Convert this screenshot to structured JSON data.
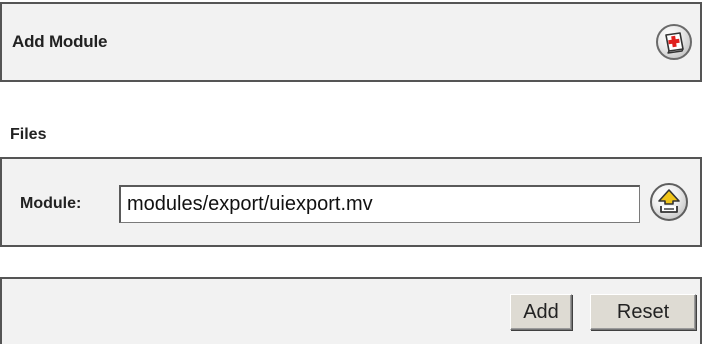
{
  "header": {
    "title": "Add Module",
    "help_icon": "help-book-icon"
  },
  "files_section": {
    "label": "Files",
    "module_label": "Module:",
    "module_value": "modules/export/uiexport.mv",
    "browse_icon": "upload-arrow-icon"
  },
  "actions": {
    "add_label": "Add",
    "reset_label": "Reset"
  },
  "colors": {
    "panel_background": "#f2f2f2",
    "panel_border": "#555555",
    "button_background": "#dedbd3",
    "icon_red": "#e0201e",
    "icon_yellow": "#f0c419"
  }
}
